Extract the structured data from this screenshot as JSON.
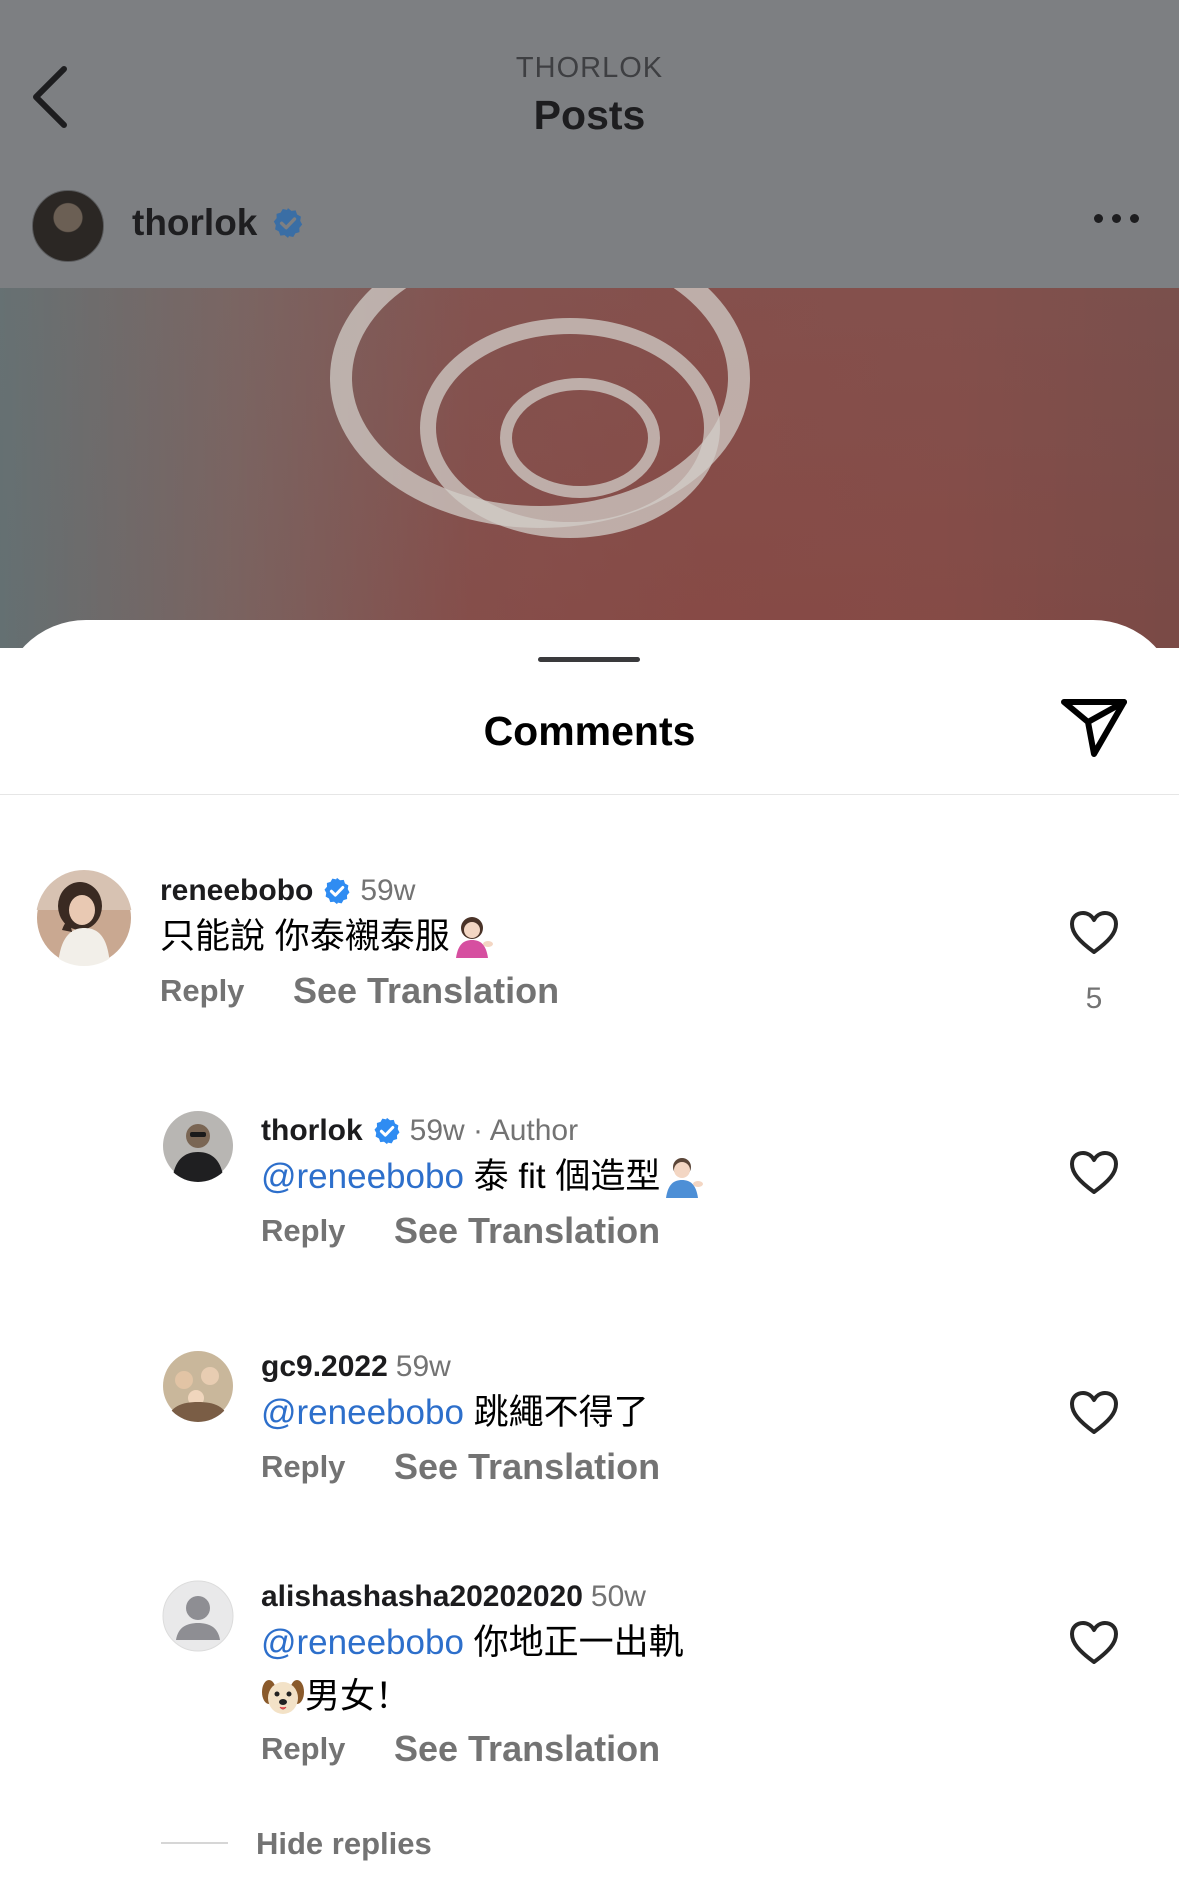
{
  "top_bar": {
    "account_label": "THORLOK",
    "title": "Posts"
  },
  "post_header": {
    "username": "thorlok",
    "verified": true
  },
  "comments_sheet": {
    "title": "Comments",
    "accent_color": "#2d6fcb",
    "hide_replies_label": "Hide replies"
  },
  "comments": [
    {
      "username": "reneebobo",
      "verified": true,
      "meta": "59w",
      "text": "只能說 你泰襯泰服",
      "emoji": "person-tipping-hand",
      "reply_label": "Reply",
      "translate_label": "See Translation",
      "likes": "5"
    },
    {
      "username": "thorlok",
      "verified": true,
      "meta": "59w · Author",
      "mention": "@reneebobo",
      "text": "泰 fit 個造型",
      "emoji": "man-tipping-hand",
      "reply_label": "Reply",
      "translate_label": "See Translation"
    },
    {
      "username": "gc9.2022",
      "meta": "59w",
      "mention": "@reneebobo",
      "text": "跳繩不得了",
      "reply_label": "Reply",
      "translate_label": "See Translation"
    },
    {
      "username": "alishashasha20202020",
      "meta": "50w",
      "mention": "@reneebobo",
      "text": "你地正一出軌",
      "text_line2": "男女！",
      "emoji": "dog-face",
      "reply_label": "Reply",
      "translate_label": "See Translation"
    }
  ]
}
